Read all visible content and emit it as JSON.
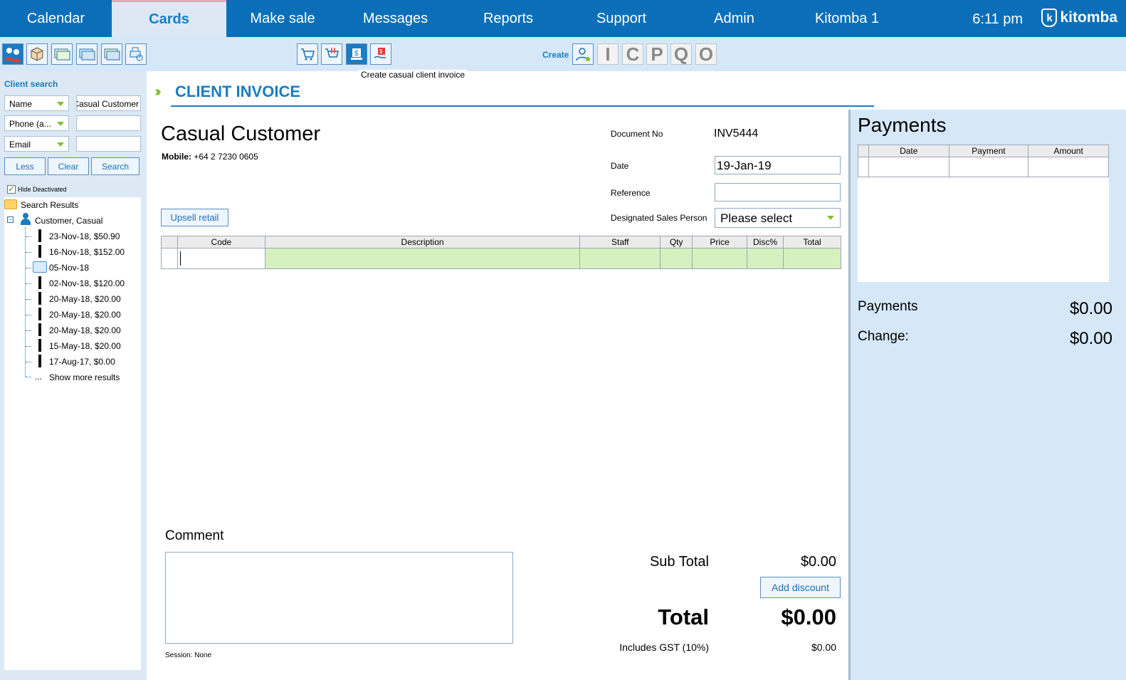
{
  "nav": {
    "tabs": [
      {
        "label": "Calendar"
      },
      {
        "label": "Cards"
      },
      {
        "label": "Make sale"
      },
      {
        "label": "Messages"
      },
      {
        "label": "Reports"
      },
      {
        "label": "Support"
      },
      {
        "label": "Admin"
      },
      {
        "label": "Kitomba 1"
      }
    ],
    "active_tab": "Cards",
    "time": "6:11 pm",
    "logo_text": "kitomba",
    "logo_mark": "k"
  },
  "toolbar": {
    "left_icons": [
      "client-card-icon",
      "product-box-icon",
      "voucher-icon",
      "account-card-icon",
      "prepaid-icon",
      "print-search-icon"
    ],
    "mid_icons": [
      "retail-cart-icon",
      "cart-return-icon",
      "casual-invoice-icon",
      "payment-hand-icon"
    ],
    "create_label": "Create",
    "create_letters": [
      "I",
      "C",
      "P",
      "Q",
      "O"
    ],
    "tooltip": "Create casual client invoice"
  },
  "sidebar": {
    "title": "Client search",
    "fields": [
      {
        "select": "Name",
        "value": "Casual Customer"
      },
      {
        "select": "Phone (a...",
        "value": ""
      },
      {
        "select": "Email",
        "value": ""
      }
    ],
    "buttons": {
      "less": "Less",
      "clear": "Clear",
      "search": "Search"
    },
    "hide_deactivated": "Hide Deactivated",
    "tree": {
      "root": "Search Results",
      "client": "Customer, Casual",
      "items": [
        "23-Nov-18, $50.90",
        "16-Nov-18, $152.00",
        "05-Nov-18",
        "02-Nov-18, $120.00",
        "20-May-18, $20.00",
        "20-May-18, $20.00",
        "20-May-18, $20.00",
        "15-May-18, $20.00",
        "17-Aug-17, $0.00"
      ],
      "more_prefix": "...",
      "more": "Show more results"
    }
  },
  "invoice": {
    "title": "CLIENT INVOICE",
    "customer_name": "Casual Customer",
    "mobile_label": "Mobile:",
    "mobile": "+64 2 7230 0605",
    "doc_no_label": "Document No",
    "doc_no": "INV5444",
    "date_label": "Date",
    "date": "19-Jan-19",
    "reference_label": "Reference",
    "reference": "",
    "sales_person_label": "Designated Sales Person",
    "sales_person": "Please select",
    "upsell_label": "Upsell retail",
    "columns": [
      "Code",
      "Description",
      "Staff",
      "Qty",
      "Price",
      "Disc%",
      "Total"
    ],
    "comment_label": "Comment",
    "comment": "",
    "session": "Session: None",
    "subtotal_label": "Sub Total",
    "subtotal": "$0.00",
    "add_discount": "Add discount",
    "total_label": "Total",
    "total": "$0.00",
    "gst_label": "Includes GST (10%)",
    "gst": "$0.00"
  },
  "payments": {
    "title": "Payments",
    "columns": [
      "Date",
      "Payment",
      "Amount"
    ],
    "payments_label": "Payments",
    "payments_value": "$0.00",
    "change_label": "Change:",
    "change_value": "$0.00"
  },
  "colors": {
    "nav_bg": "#0a6fb8",
    "accent": "#1a7cc2",
    "green": "#7cc52a",
    "panel_bg": "#d6e8f8"
  }
}
